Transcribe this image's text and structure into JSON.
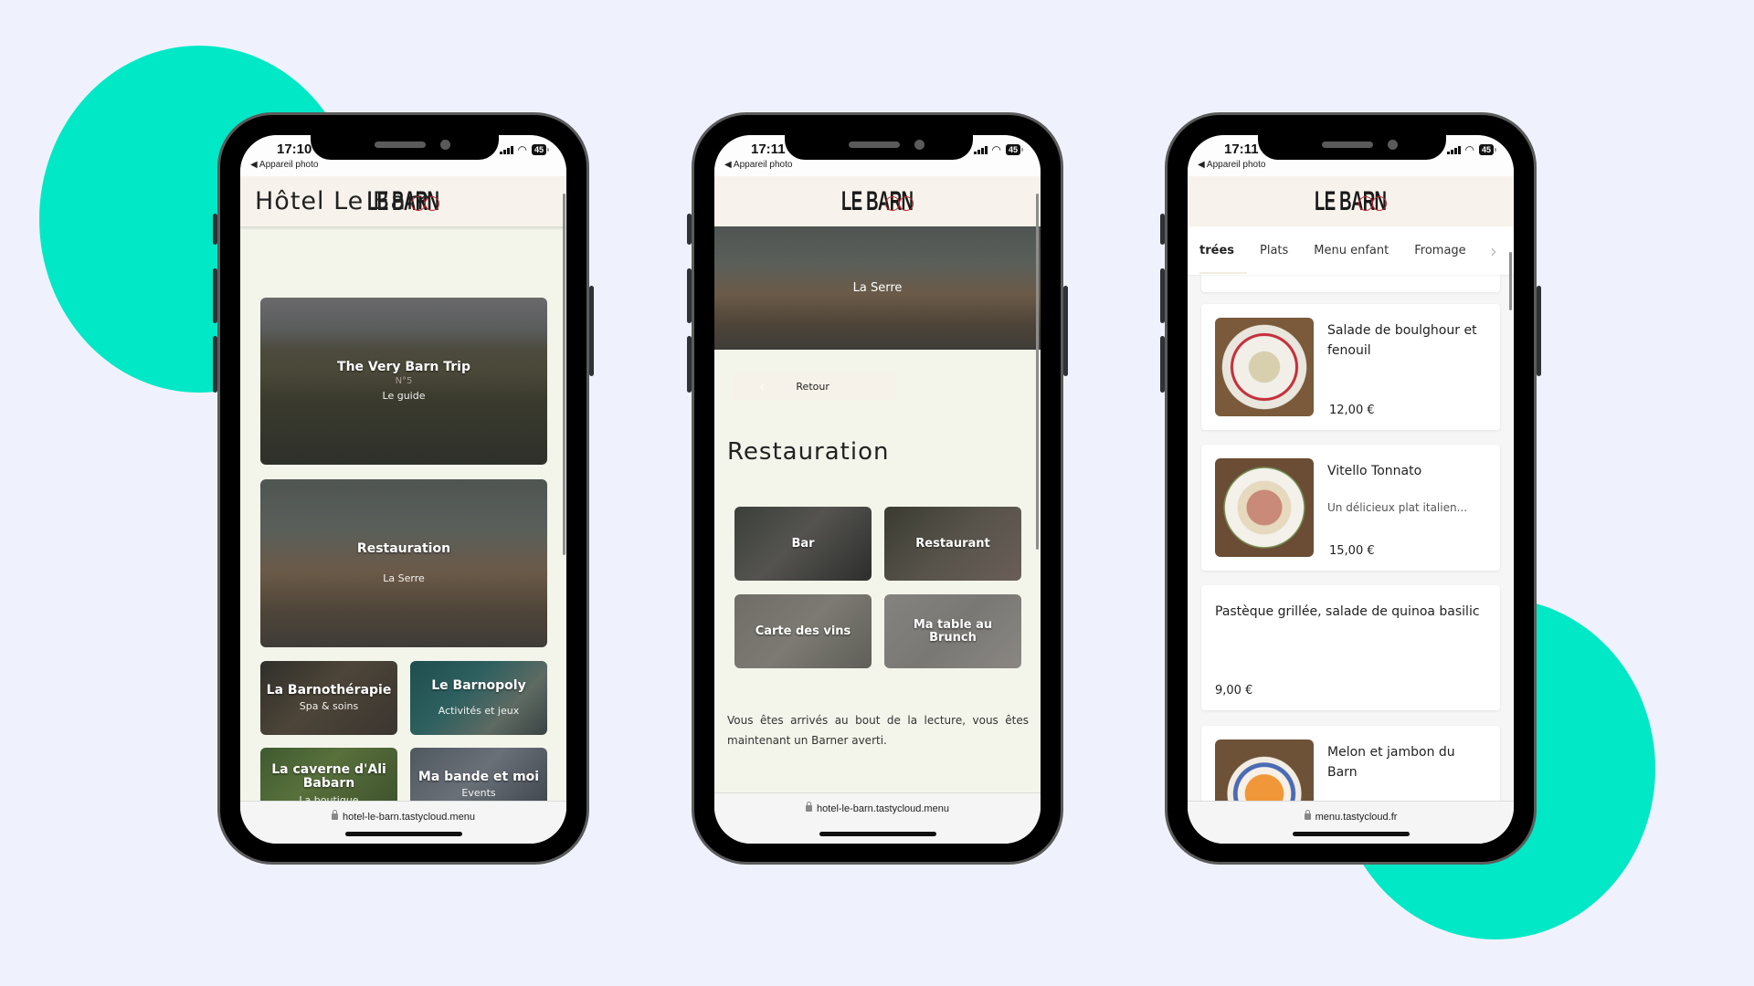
{
  "colors": {
    "background": "#eff2fd",
    "accent_blob": "#00e8c6",
    "logo_ring": "#c0262d",
    "header_bg": "#f7f3ec",
    "page_bg": "#f3f5ea"
  },
  "status_bar": {
    "back_app": "◀ Appareil photo",
    "battery": "45"
  },
  "brand": {
    "logo": "LE BARN"
  },
  "phones": [
    {
      "time": "17:10",
      "page_title": "Hôtel Le Barn",
      "featured": [
        {
          "title": "The Very Barn Trip",
          "number": "N°5",
          "subtitle": "Le guide"
        },
        {
          "title": "Restauration",
          "subtitle": "La Serre"
        }
      ],
      "tiles": [
        {
          "title": "La Barnothérapie",
          "subtitle": "Spa & soins"
        },
        {
          "title": "Le Barnopoly",
          "subtitle": "Activités et jeux"
        },
        {
          "title": "La caverne d'Ali Babarn",
          "subtitle": "La boutique"
        },
        {
          "title": "Ma bande et moi",
          "subtitle": "Events"
        }
      ],
      "url": "hotel-le-barn.tastycloud.menu"
    },
    {
      "time": "17:11",
      "hero_caption": "La Serre",
      "back_label": "Retour",
      "section_title": "Restauration",
      "tiles": [
        {
          "title": "Bar"
        },
        {
          "title": "Restaurant"
        },
        {
          "title": "Carte des vins"
        },
        {
          "title": "Ma table au Brunch"
        }
      ],
      "paragraph": "Vous êtes arrivés au bout de la lecture, vous êtes maintenant un Barner averti.",
      "url": "hotel-le-barn.tastycloud.menu"
    },
    {
      "time": "17:11",
      "tabs": [
        {
          "label": "Entrées",
          "visible_label": "trées",
          "active": true
        },
        {
          "label": "Plats"
        },
        {
          "label": "Menu enfant"
        },
        {
          "label": "Fromage"
        }
      ],
      "items": [
        {
          "name": "Salade de boulghour et fenouil",
          "description": "",
          "price": "12,00 €",
          "image": "salad"
        },
        {
          "name": "Vitello Tonnato",
          "description": "Un délicieux plat italien...",
          "price": "15,00 €",
          "image": "vitello"
        },
        {
          "name": "Pastèque grillée, salade de quinoa basilic",
          "description": "",
          "price": "9,00 €",
          "image": ""
        },
        {
          "name": "Melon et jambon du Barn",
          "description": "",
          "price": "",
          "image": "melon"
        }
      ],
      "url": "menu.tastycloud.fr"
    }
  ]
}
